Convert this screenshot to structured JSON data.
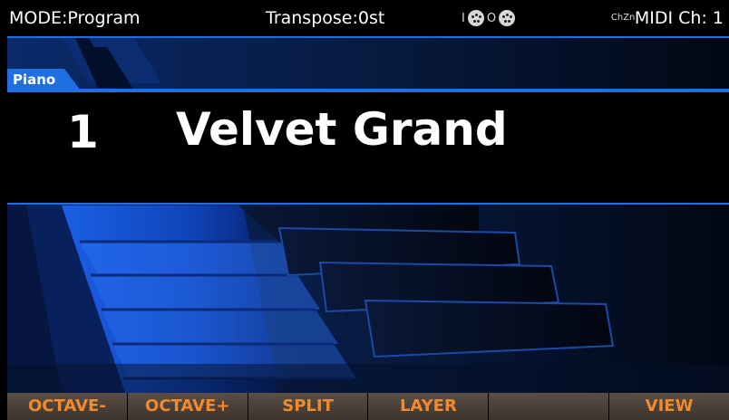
{
  "status": {
    "mode": "MODE:Program",
    "transpose": "Transpose:0st",
    "midi_in_label": "I",
    "midi_out_label": "O",
    "midi_channel": "MIDI Ch: 1",
    "chzn_label": "ChZn"
  },
  "program": {
    "category": "Piano",
    "number": "1",
    "name": "Velvet Grand"
  },
  "softkeys": [
    "OCTAVE-",
    "OCTAVE+",
    "SPLIT",
    "LAYER",
    "",
    "VIEW"
  ],
  "colors": {
    "accent": "#1f6fe0",
    "softkey_text": "#f08a2c",
    "softkey_bg": "#4a3f38"
  }
}
